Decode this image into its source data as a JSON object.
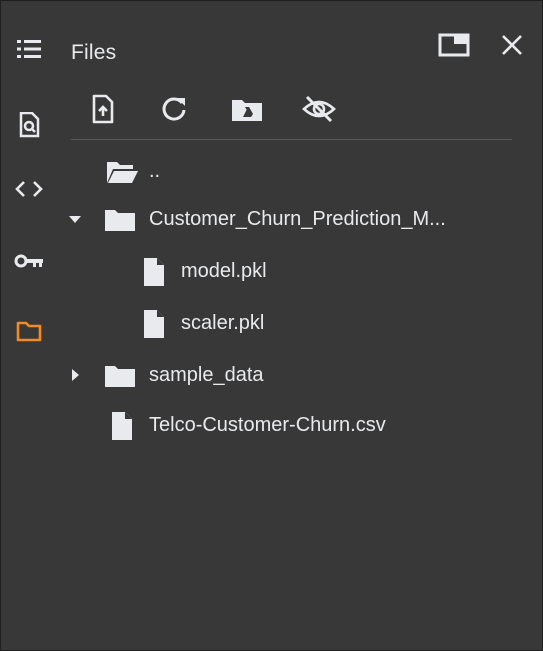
{
  "panel": {
    "title": "Files"
  },
  "rail": {
    "items": [
      {
        "icon": "table-of-contents-icon"
      },
      {
        "icon": "find-replace-icon"
      },
      {
        "icon": "code-snippets-icon"
      },
      {
        "icon": "secrets-key-icon"
      },
      {
        "icon": "folder-icon",
        "active": true
      }
    ]
  },
  "header_actions": [
    {
      "icon": "open-in-tab-icon"
    },
    {
      "icon": "close-icon"
    }
  ],
  "toolbar": [
    {
      "icon": "upload-file-icon"
    },
    {
      "icon": "refresh-icon"
    },
    {
      "icon": "mount-drive-icon"
    },
    {
      "icon": "hide-hidden-files-icon"
    }
  ],
  "tree": {
    "parent": "..",
    "folder_1": "Customer_Churn_Prediction_M...",
    "file_1": "model.pkl",
    "file_2": "scaler.pkl",
    "folder_2": "sample_data",
    "file_3": "Telco-Customer-Churn.csv"
  },
  "colors": {
    "background": "#383838",
    "text": "#e8eaed",
    "icon": "#e8eaed",
    "active_accent": "#f28b23"
  }
}
